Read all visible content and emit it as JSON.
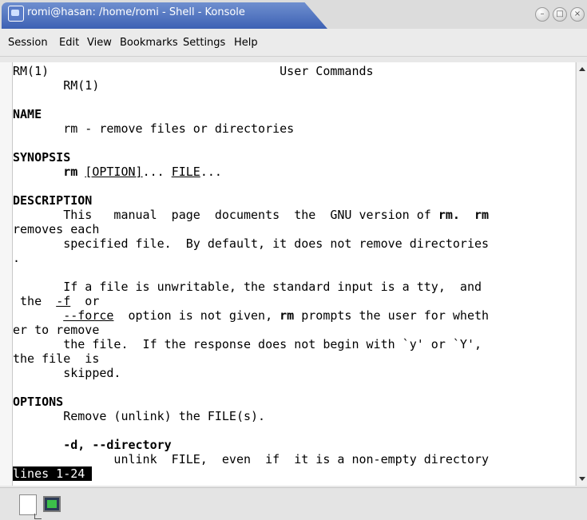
{
  "window": {
    "title": "romi@hasan: /home/romi - Shell - Konsole"
  },
  "menubar": [
    "Session",
    "Edit",
    "View",
    "Bookmarks",
    "Settings",
    "Help"
  ],
  "terminal": {
    "lines": [
      [
        {
          "t": "RM(1)                                User Commands"
        }
      ],
      [
        {
          "t": "       RM(1)"
        }
      ],
      [
        {
          "t": ""
        }
      ],
      [
        {
          "t": "NAME",
          "b": true
        }
      ],
      [
        {
          "t": "       rm - remove files or directories"
        }
      ],
      [
        {
          "t": ""
        }
      ],
      [
        {
          "t": "SYNOPSIS",
          "b": true
        }
      ],
      [
        {
          "t": "       "
        },
        {
          "t": "rm",
          "b": true
        },
        {
          "t": " "
        },
        {
          "t": "[OPTION]",
          "u": true
        },
        {
          "t": "... "
        },
        {
          "t": "FILE",
          "u": true
        },
        {
          "t": "..."
        }
      ],
      [
        {
          "t": ""
        }
      ],
      [
        {
          "t": "DESCRIPTION",
          "b": true
        }
      ],
      [
        {
          "t": "       This   manual  page  documents  the  GNU version of "
        },
        {
          "t": "rm.",
          "b": true
        },
        {
          "t": "  "
        },
        {
          "t": "rm",
          "b": true
        }
      ],
      [
        {
          "t": "removes each"
        }
      ],
      [
        {
          "t": "       specified file.  By default, it does not remove directories"
        }
      ],
      [
        {
          "t": "."
        }
      ],
      [
        {
          "t": ""
        }
      ],
      [
        {
          "t": "       If a file is unwritable, the standard input is a tty,  and"
        }
      ],
      [
        {
          "t": " the  "
        },
        {
          "t": "-f",
          "u": true
        },
        {
          "t": "  or"
        }
      ],
      [
        {
          "t": "       "
        },
        {
          "t": "--force",
          "u": true
        },
        {
          "t": "  option is not given, "
        },
        {
          "t": "rm",
          "b": true
        },
        {
          "t": " prompts the user for wheth"
        }
      ],
      [
        {
          "t": "er to remove"
        }
      ],
      [
        {
          "t": "       the file.  If the response does not begin with `y' or `Y',"
        }
      ],
      [
        {
          "t": "the file  is"
        }
      ],
      [
        {
          "t": "       skipped."
        }
      ],
      [
        {
          "t": ""
        }
      ],
      [
        {
          "t": "OPTIONS",
          "b": true
        }
      ],
      [
        {
          "t": "       Remove (unlink) the FILE(s)."
        }
      ],
      [
        {
          "t": ""
        }
      ],
      [
        {
          "t": "       "
        },
        {
          "t": "-d, --directory",
          "b": true
        }
      ],
      [
        {
          "t": "              unlink  FILE,  even  if  it is a non-empty directory"
        }
      ],
      [
        {
          "t": "lines 1-24 ",
          "s": true
        }
      ]
    ]
  },
  "icons": {
    "app": "konsole-icon",
    "minimize": "minimize-icon",
    "maximize": "maximize-icon",
    "close": "close-icon",
    "new_session": "new-session-icon",
    "session_tab": "terminal-icon"
  }
}
